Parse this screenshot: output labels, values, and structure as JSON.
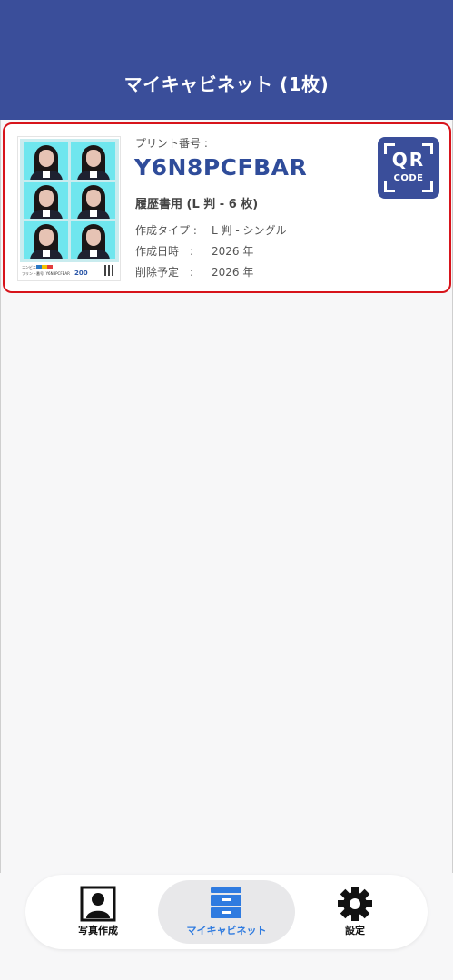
{
  "header": {
    "title": "マイキャビネット (1枚)"
  },
  "card": {
    "print_number_label": "プリント番号 :",
    "print_code": "Y6N8PCFBAR",
    "print_type": "履歴書用 (L 判 - 6 枚)",
    "details": [
      {
        "key": "作成タイプ :",
        "value": "L 判 - シングル"
      },
      {
        "key": "作成日時　:",
        "value": "2026 年"
      },
      {
        "key": "削除予定　:",
        "value": "2026 年"
      }
    ],
    "qr_button": {
      "line1": "QR",
      "line2": "CODE"
    },
    "thumbnail": {
      "brand": "コンビニ",
      "print_text": "プリント番号: Y6N8PCFBAR",
      "price": "200"
    }
  },
  "tabbar": {
    "tabs": [
      {
        "label": "写真作成",
        "icon": "portrait-icon",
        "active": false
      },
      {
        "label": "マイキャビネット",
        "icon": "cabinet-icon",
        "active": true
      },
      {
        "label": "設定",
        "icon": "gear-icon",
        "active": false
      }
    ]
  },
  "colors": {
    "header_bg": "#3a4e9a",
    "accent_blue": "#2f4c9a",
    "active_tab": "#2f7be0",
    "card_border": "#d7141b"
  }
}
